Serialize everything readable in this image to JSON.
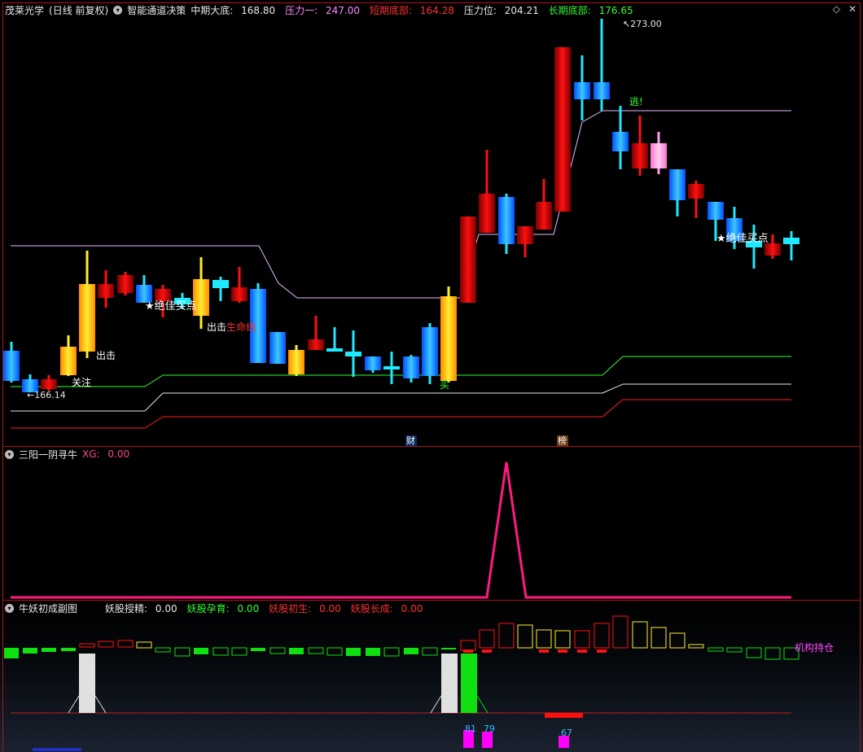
{
  "main": {
    "stock": "茂莱光学",
    "period": "(日线 前复权)",
    "indicator": "智能通道决策",
    "fields": [
      {
        "label": "中期大底:",
        "value": "168.80",
        "color": "#e8e8e8"
      },
      {
        "label": "压力一:",
        "value": "247.00",
        "color": "#ff88ff"
      },
      {
        "label": "短期底部:",
        "value": "164.28",
        "color": "#ff3030"
      },
      {
        "label": "压力位:",
        "value": "204.21",
        "color": "#e8e8e8"
      },
      {
        "label": "长期底部:",
        "value": "176.65",
        "color": "#30ff30"
      }
    ],
    "high_label": "273.00",
    "low_label": "166.14",
    "annotations": {
      "chuji": "出击",
      "guanzhu": "关注",
      "juejia1": "★绝佳买点",
      "shengming": "生命线",
      "chuji2": "出击",
      "mai": "买",
      "tao": "逃!",
      "juejia2": "★绝佳买点"
    },
    "markers": {
      "cai": "财",
      "bang": "榜"
    }
  },
  "sub1": {
    "title": "三阳一阴寻牛",
    "field_label": "XG:",
    "field_value": "0.00"
  },
  "sub2": {
    "title": "牛妖初成副图",
    "fields": [
      {
        "label": "妖股授精:",
        "value": "0.00",
        "color": "#e8e8e8"
      },
      {
        "label": "妖股孕育:",
        "value": "0.00",
        "color": "#30ff30"
      },
      {
        "label": "妖股初生:",
        "value": "0.00",
        "color": "#ff3030"
      },
      {
        "label": "妖股长成:",
        "value": "0.00",
        "color": "#ff3030"
      }
    ],
    "side_label": "机构持仓",
    "bottom_values": [
      "81",
      "79",
      "67"
    ]
  }
}
